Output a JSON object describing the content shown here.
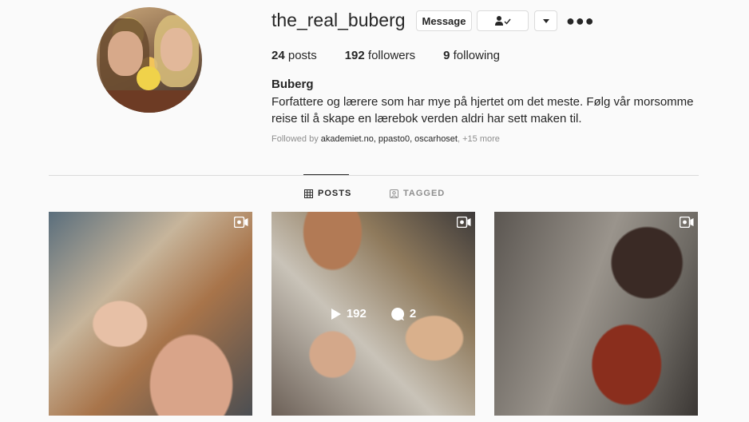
{
  "profile": {
    "username": "the_real_buberg",
    "message_label": "Message",
    "posts_count": "24",
    "posts_label": "posts",
    "followers_count": "192",
    "followers_label": "followers",
    "following_count": "9",
    "following_label": "following",
    "name": "Buberg",
    "bio": "Forfattere og lærere som har mye på hjertet om det meste. Følg vår morsomme reise til å skape en lærebok verden aldri har sett maken til.",
    "followed_by_prefix": "Followed by",
    "followed_by_users": "akademiet.no, ppasto0, oscarhoset",
    "followed_by_more": "+15 more"
  },
  "tabs": [
    {
      "label": "POSTS",
      "icon": "grid-icon",
      "active": true
    },
    {
      "label": "TAGGED",
      "icon": "tagged-icon",
      "active": false
    }
  ],
  "posts": [
    {
      "type": "video",
      "icon": "igtv-icon"
    },
    {
      "type": "video",
      "icon": "igtv-icon",
      "views": "192",
      "comments": "2"
    },
    {
      "type": "video",
      "icon": "igtv-icon"
    }
  ],
  "colors": {
    "background": "#fafafa",
    "border": "#dbdbdb",
    "text": "#262626",
    "muted": "#8e8e8e"
  }
}
